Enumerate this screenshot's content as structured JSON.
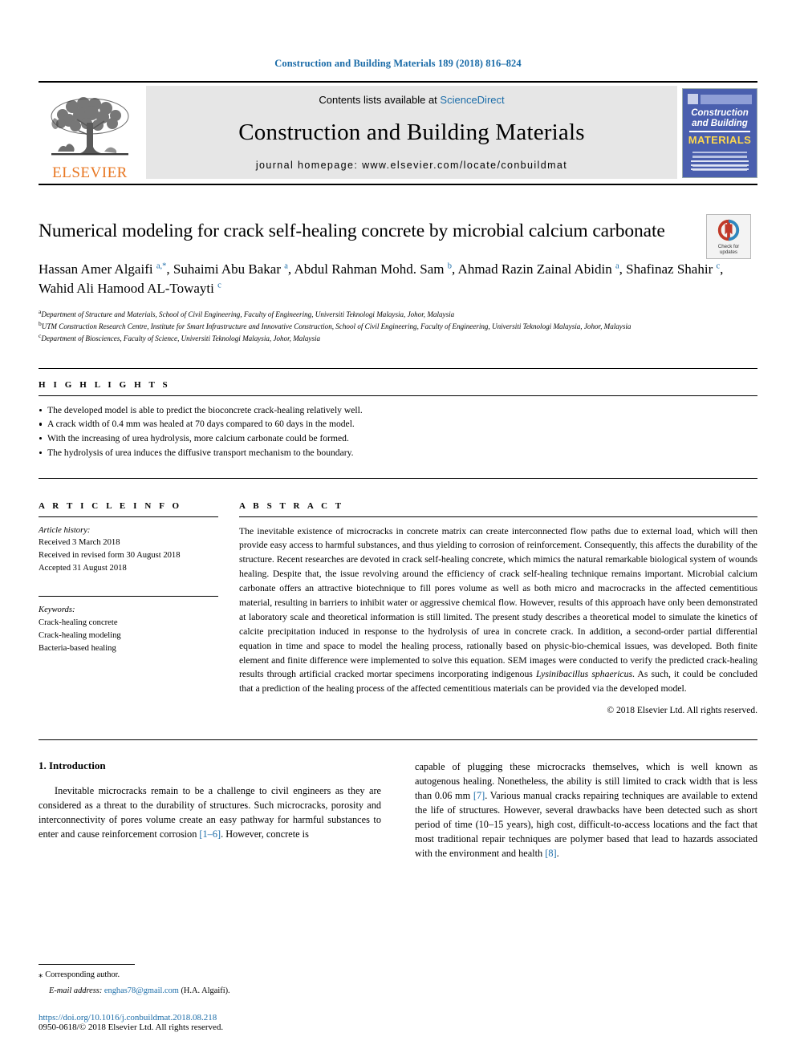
{
  "running_head": "Construction and Building Materials 189 (2018) 816–824",
  "masthead": {
    "publisher_logo_text": "ELSEVIER",
    "contents_prefix": "Contents lists available at",
    "contents_link": "ScienceDirect",
    "journal_title": "Construction and Building Materials",
    "homepage_line": "journal homepage: www.elsevier.com/locate/conbuildmat",
    "cover": {
      "line1": "Construction",
      "line2": "and Building",
      "line3": "MATERIALS"
    }
  },
  "article": {
    "title": "Numerical modeling for crack self-healing concrete by microbial calcium carbonate",
    "crossmark_label_1": "Check for",
    "crossmark_label_2": "updates",
    "authors_html": "Hassan Amer Algaifi <sup>a,*</sup>, Suhaimi Abu Bakar <sup>a</sup>, Abdul Rahman Mohd. Sam <sup>b</sup>, Ahmad Razin Zainal Abidin <sup>a</sup>, Shafinaz Shahir <sup>c</sup>, Wahid Ali Hamood AL-Towayti <sup>c</sup>",
    "affiliations": [
      "Department of Structure and Materials, School of Civil Engineering, Faculty of Engineering, Universiti Teknologi Malaysia, Johor, Malaysia",
      "UTM Construction Research Centre, Institute for Smart Infrastructure and Innovative Construction, School of Civil Engineering, Faculty of Engineering, Universiti Teknologi Malaysia, Johor, Malaysia",
      "Department of Biosciences, Faculty of Science, Universiti Teknologi Malaysia, Johor, Malaysia"
    ],
    "affiliation_marks": [
      "a",
      "b",
      "c"
    ]
  },
  "highlights": {
    "heading": "H I G H L I G H T S",
    "items": [
      "The developed model is able to predict the bioconcrete crack-healing relatively well.",
      "A crack width of 0.4 mm was healed at 70 days compared to 60 days in the model.",
      "With the increasing of urea hydrolysis, more calcium carbonate could be formed.",
      "The hydrolysis of urea induces the diffusive transport mechanism to the boundary."
    ]
  },
  "article_info": {
    "heading": "A R T I C L E   I N F O",
    "history_label": "Article history:",
    "history": [
      "Received 3 March 2018",
      "Received in revised form 30 August 2018",
      "Accepted 31 August 2018"
    ],
    "keywords_label": "Keywords:",
    "keywords": [
      "Crack-healing concrete",
      "Crack-healing modeling",
      "Bacteria-based healing"
    ]
  },
  "abstract": {
    "heading": "A B S T R A C T",
    "part1": "The inevitable existence of microcracks in concrete matrix can create interconnected flow paths due to external load, which will then provide easy access to harmful substances, and thus yielding to corrosion of reinforcement. Consequently, this affects the durability of the structure. Recent researches are devoted in crack self-healing concrete, which mimics the natural remarkable biological system of wounds healing. Despite that, the issue revolving around the efficiency of crack self-healing technique remains important. Microbial calcium carbonate offers an attractive biotechnique to fill pores volume as well as both micro and macrocracks in the affected cementitious material, resulting in barriers to inhibit water or aggressive chemical flow. However, results of this approach have only been demonstrated at laboratory scale and theoretical information is still limited. The present study describes a theoretical model to simulate the kinetics of calcite precipitation induced in response to the hydrolysis of urea in concrete crack. In addition, a second-order partial differential equation in time and space to model the healing process, rationally based on physic-bio-chemical issues, was developed. Both finite element and finite difference were implemented to solve this equation. SEM images were conducted to verify the predicted crack-healing results through artificial cracked mortar specimens incorporating indigenous ",
    "italic_species": "Lysinibacillus sphaericus",
    "part2": ". As such, it could be concluded that a prediction of the healing process of the affected cementitious materials can be provided via the developed model.",
    "copyright": "© 2018 Elsevier Ltd. All rights reserved."
  },
  "introduction": {
    "heading": "1. Introduction",
    "col1_pre": "Inevitable microcracks remain to be a challenge to civil engineers as they are considered as a threat to the durability of structures. Such microcracks, porosity and interconnectivity of pores volume create an easy pathway for harmful substances to enter and cause reinforcement corrosion ",
    "col1_ref": "[1–6]",
    "col1_post": ". However, concrete is",
    "col2_pre": "capable of plugging these microcracks themselves, which is well known as autogenous healing. Nonetheless, the ability is still limited to crack width that is less than 0.06 mm ",
    "col2_ref1": "[7]",
    "col2_mid": ". Various manual cracks repairing techniques are available to extend the life of structures. However, several drawbacks have been detected such as short period of time (10–15 years), high cost, difficult-to-access locations and the fact that most traditional repair techniques are polymer based that lead to hazards associated with the environment and health ",
    "col2_ref2": "[8]",
    "col2_post": "."
  },
  "footer": {
    "corresponding_star": "⁎",
    "corresponding_label": "Corresponding author.",
    "email_label": "E-mail address:",
    "email": "enghas78@gmail.com",
    "email_attrib": "(H.A. Algaifi).",
    "doi": "https://doi.org/10.1016/j.conbuildmat.2018.08.218",
    "issn_line": "0950-0618/© 2018 Elsevier Ltd. All rights reserved."
  },
  "colors": {
    "link_blue": "#1b6ca8",
    "elsevier_orange": "#E87722",
    "band_gray": "#e6e6e6",
    "cover_blue": "#4a5fae"
  }
}
